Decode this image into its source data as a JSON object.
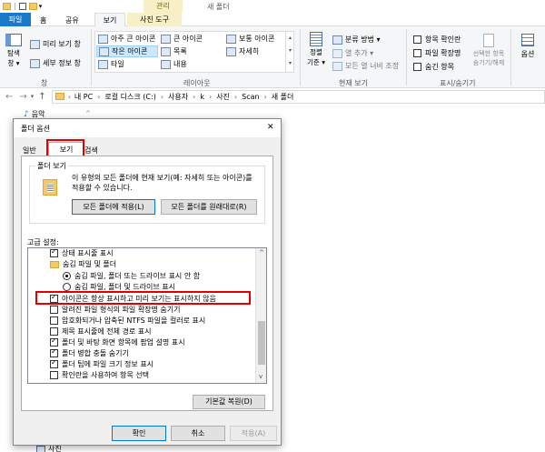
{
  "title_bar": {
    "context_tab": "관리",
    "window_title": "새 폴더"
  },
  "ribbon_tabs": [
    "파일",
    "홈",
    "공유",
    "보기",
    "사진 도구"
  ],
  "ribbon": {
    "pane_group": {
      "nav_pane": "탐색\n창 ▾",
      "preview": "미리 보기 창",
      "details": "세부 정보 창",
      "label": "창"
    },
    "layout_group": {
      "items": [
        "아주 큰 아이콘",
        "큰 아이콘",
        "보통 아이콘",
        "작은 아이콘",
        "목록",
        "자세히",
        "타일",
        "내용"
      ],
      "label": "레이아웃"
    },
    "current_view": {
      "sort": "정렬\n기준 ▾",
      "group_by": "분류 방법 ▾",
      "add_columns": "열 추가 ▾",
      "fit_columns": "모든 열 너비 조정",
      "label": "현재 보기"
    },
    "show_hide": {
      "item_checkbox": "항목 확인란",
      "file_ext": "파일 확장명",
      "hidden_items": "숨긴 항목",
      "hide_selected": "선택한 항목\n숨기기/해제",
      "label": "표시/숨기기"
    },
    "options": "옵션"
  },
  "address_bar": {
    "path": [
      "내 PC",
      "로컬 디스크 (C:)",
      "사용자",
      "k",
      "사진",
      "Scan",
      "새 폴더"
    ]
  },
  "sidebar": {
    "items": [
      "음악",
      "사진"
    ]
  },
  "dialog": {
    "title": "폴더 옵션",
    "close": "✕",
    "tabs": [
      "일반",
      "보기",
      "검색"
    ],
    "folder_views": {
      "legend": "폴더 보기",
      "description": "이 유형의 모든 폴더에 현재 보기(예: 자세히 또는 아이콘)를 적용할 수 있습니다.",
      "apply_button": "모든 폴더에 적용(L)",
      "reset_button": "모든 폴더를 원래대로(R)"
    },
    "advanced_label": "고급 설정:",
    "settings": [
      {
        "type": "checkbox",
        "checked": true,
        "indent": 1,
        "label": "상태 표시줄 표시"
      },
      {
        "type": "folder",
        "checked": false,
        "indent": 1,
        "label": "숨김 파일 및 폴더"
      },
      {
        "type": "radio",
        "checked": true,
        "indent": 2,
        "label": "숨김 파일, 폴더 또는 드라이브 표시 안 함"
      },
      {
        "type": "radio",
        "checked": false,
        "indent": 2,
        "label": "숨김 파일, 폴더 및 드라이브 표시"
      },
      {
        "type": "checkbox",
        "checked": true,
        "indent": 1,
        "label": "아이콘은 항상 표시하고 미리 보기는 표시하지 않음"
      },
      {
        "type": "checkbox",
        "checked": false,
        "indent": 1,
        "label": "알려진 파일 형식의 파일 확장명 숨기기"
      },
      {
        "type": "checkbox",
        "checked": false,
        "indent": 1,
        "label": "암호화되거나 압축된 NTFS 파일을 컬러로 표시"
      },
      {
        "type": "checkbox",
        "checked": false,
        "indent": 1,
        "label": "제목 표시줄에 전체 경로 표시"
      },
      {
        "type": "checkbox",
        "checked": true,
        "indent": 1,
        "label": "폴더 및 바탕 화면 항목에 팝업 설명 표시"
      },
      {
        "type": "checkbox",
        "checked": true,
        "indent": 1,
        "label": "폴더 병합 충돌 숨기기"
      },
      {
        "type": "checkbox",
        "checked": true,
        "indent": 1,
        "label": "폴더 팁에 파일 크기 정보 표시"
      },
      {
        "type": "checkbox",
        "checked": false,
        "indent": 1,
        "label": "확인란을 사용하여 항목 선택"
      }
    ],
    "restore_defaults": "기본값 복원(D)",
    "ok": "확인",
    "cancel": "취소",
    "apply": "적용(A)"
  },
  "colors": {
    "accent": "#1979ca",
    "highlight_red": "#e00000",
    "context_tab_bg": "#f7efc5"
  }
}
